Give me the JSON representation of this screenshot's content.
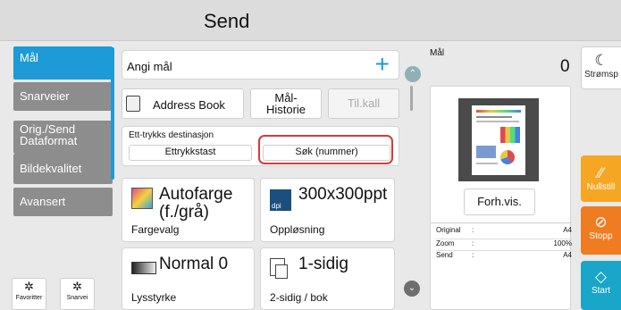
{
  "header": {
    "title": "Send"
  },
  "sidebar": {
    "items": [
      {
        "label": "Mål"
      },
      {
        "label": "Snarveier"
      },
      {
        "label": "Orig./Send\nDataformat"
      },
      {
        "label": "Bildekvalitet"
      },
      {
        "label": "Avansert"
      }
    ],
    "favorites": [
      {
        "label": "Favoritter",
        "icon": "gear-star-icon"
      },
      {
        "label": "Snarvei",
        "icon": "gear-star-icon"
      }
    ]
  },
  "destination": {
    "enter_label": "Angi mål",
    "add_icon": "plus-icon",
    "address_book_label": "Address Book",
    "history_label": "Mål-\nHistorie",
    "recall_label": "Til.kall",
    "one_touch_title": "Ett-trykks destinasjon",
    "one_touch_key_label": "Ettrykkstast",
    "search_number_label": "Søk (nummer)"
  },
  "settings": {
    "color": {
      "value": "Autofarge\n(f./grå)",
      "label": "Fargevalg"
    },
    "resolution": {
      "value": "300x300ppt",
      "label": "Oppløsning",
      "badge": "dpi"
    },
    "density": {
      "value": "Normal 0",
      "label": "Lysstyrke"
    },
    "duplex": {
      "value": "1-sidig",
      "label": "2-sidig / bok"
    }
  },
  "preview": {
    "target_label": "Mål",
    "target_count": "0",
    "preview_button_label": "Forh.vis.",
    "info": [
      {
        "key": "Original",
        "sep": ":",
        "value": "A4"
      },
      {
        "key": "Zoom",
        "sep": ":",
        "value": "100%"
      },
      {
        "key": "Send",
        "sep": ":",
        "value": "A4"
      }
    ]
  },
  "right_panel": {
    "power_label": "Strømsp",
    "reset_label": "Nullstill",
    "stop_label": "Stopp",
    "start_label": "Start",
    "colors": {
      "reset": "#f5a623",
      "stop": "#f07c22",
      "start": "#1aa6c8"
    }
  },
  "colors": {
    "accent": "#1e9ad6",
    "highlight": "#d93a3a"
  }
}
